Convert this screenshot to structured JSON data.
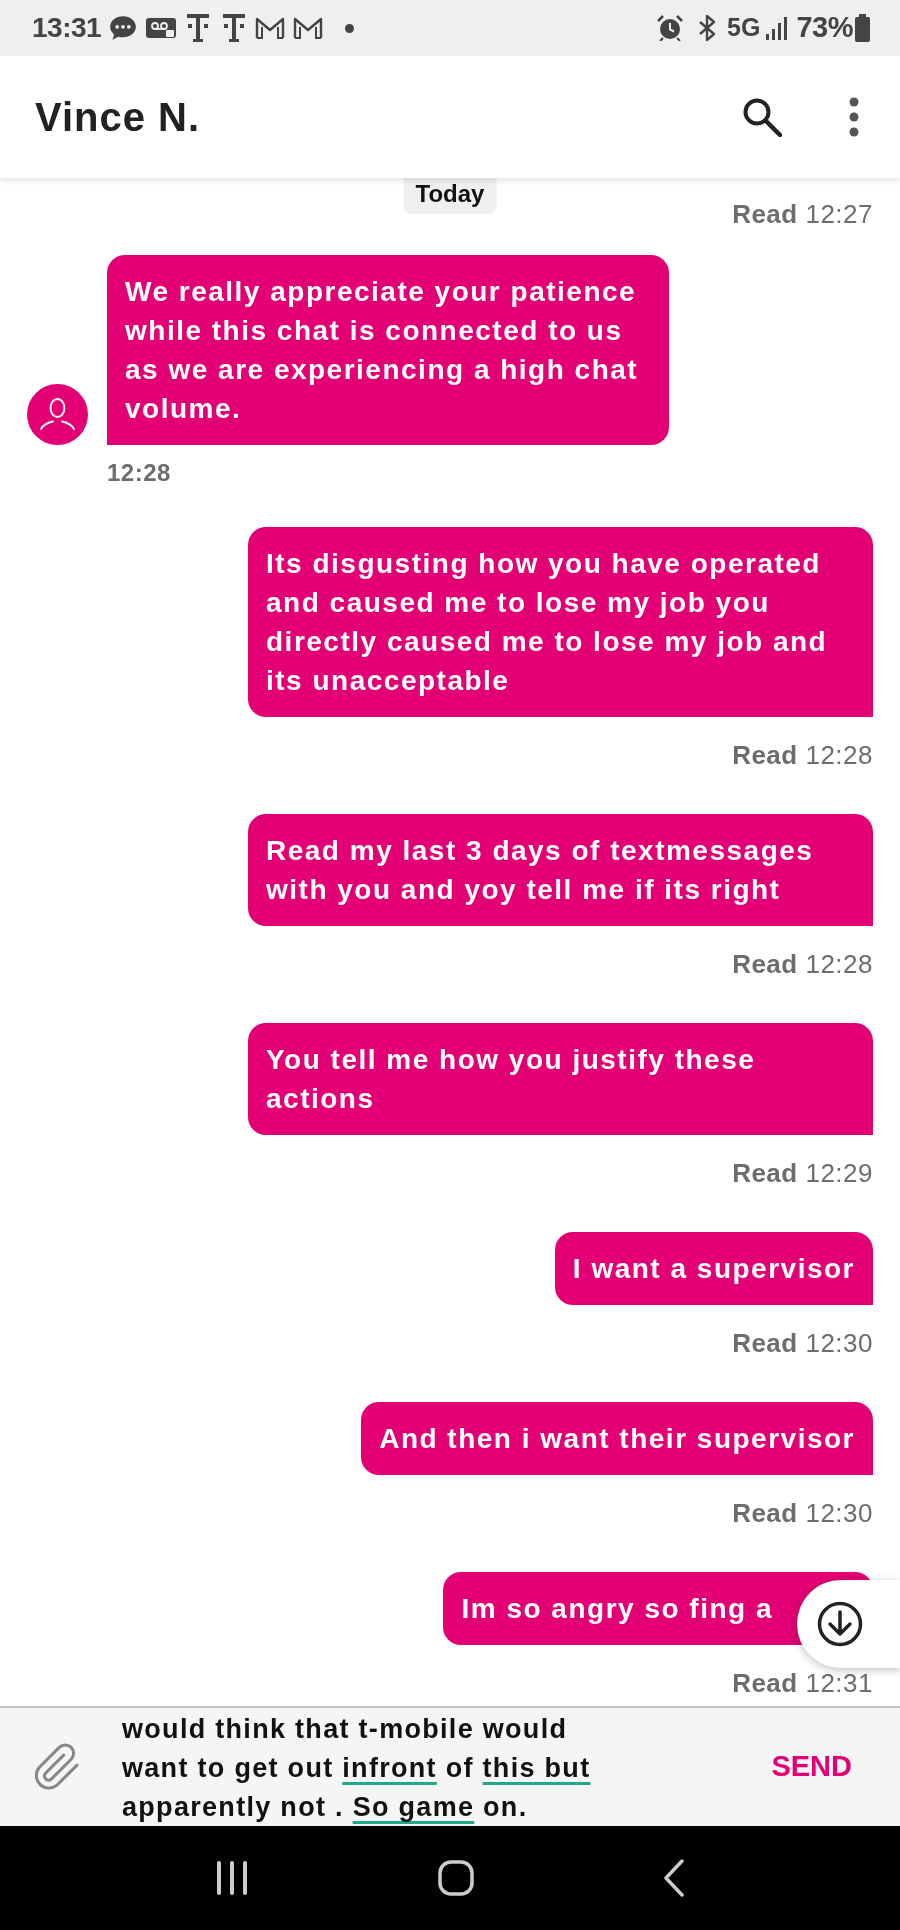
{
  "status_bar": {
    "time": "13:31",
    "network": "5G",
    "battery": "73%"
  },
  "header": {
    "title": "Vince N."
  },
  "date_chip": "Today",
  "conversation": [
    {
      "kind": "receipt",
      "text": "**Read** 12:27"
    },
    {
      "kind": "incoming",
      "text": "We really appreciate your patience while this chat is connected to us as we are experiencing a high chat volume.",
      "time": "12:28"
    },
    {
      "kind": "outgoing",
      "text": "Its disgusting how you have operated and caused me to lose my job you directly caused me to lose my job and its unacceptable",
      "receipt": "**Read** 12:28"
    },
    {
      "kind": "outgoing",
      "text": "Read my last 3 days of textmessages with you and yoy tell me if its right",
      "receipt": "**Read** 12:28"
    },
    {
      "kind": "outgoing",
      "text": "You tell me how you justify these actions",
      "receipt": "**Read** 12:29"
    },
    {
      "kind": "outgoing",
      "text": "I want a supervisor",
      "receipt": "**Read** 12:30"
    },
    {
      "kind": "outgoing",
      "text": "And then i want their supervisor",
      "receipt": "**Read** 12:30"
    },
    {
      "kind": "outgoing",
      "text": "Im so angry so fing a",
      "receipt": "**Read** 12:31"
    }
  ],
  "composer": {
    "segments": [
      {
        "text": "would think that t-mobile would want to get out ",
        "underlined": false
      },
      {
        "text": "infront",
        "underlined": true
      },
      {
        "text": " of ",
        "underlined": false
      },
      {
        "text": "this but",
        "underlined": true
      },
      {
        "text": " apparently not . ",
        "underlined": false
      },
      {
        "text": "So game",
        "underlined": true
      },
      {
        "text": " on.",
        "underlined": false
      }
    ],
    "send_label": "SEND"
  }
}
